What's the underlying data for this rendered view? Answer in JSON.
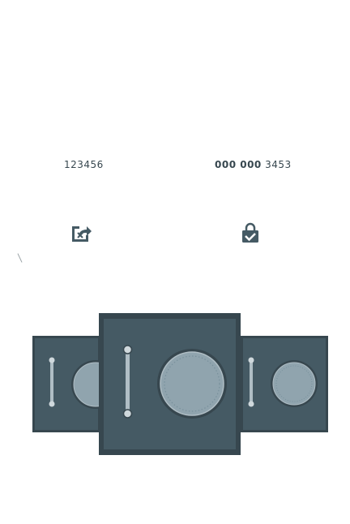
{
  "codes": {
    "left": "123456",
    "right_bold": "000 000",
    "right_rest": "3453"
  },
  "icons": {
    "share": "share-out-icon",
    "verify": "lock-check-icon",
    "safe": "vault-safe-icon"
  },
  "colors": {
    "text": "#37474f",
    "icon": "#455a64",
    "safe_body": "#37474f",
    "safe_face": "#455a64",
    "dial": "#90a4ae",
    "handle": "#b0bec5"
  }
}
